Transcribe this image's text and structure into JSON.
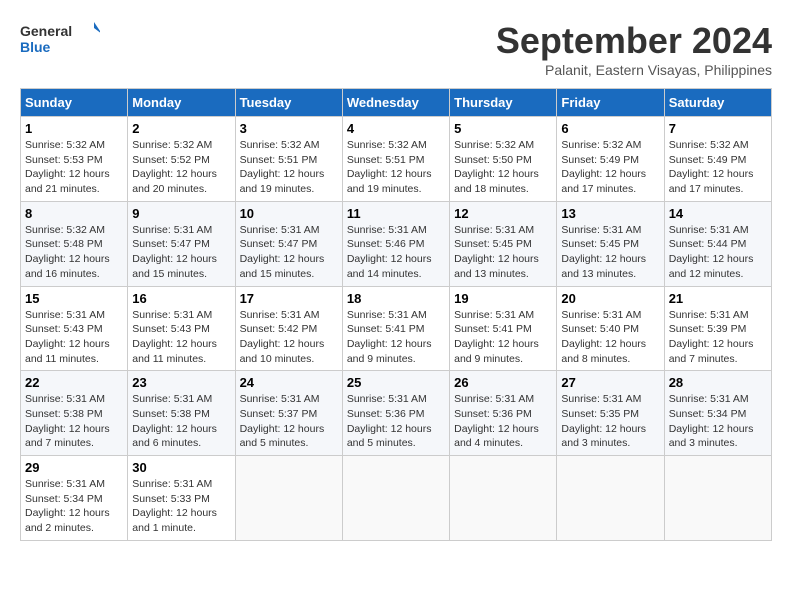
{
  "header": {
    "logo_line1": "General",
    "logo_line2": "Blue",
    "month": "September 2024",
    "location": "Palanit, Eastern Visayas, Philippines"
  },
  "weekdays": [
    "Sunday",
    "Monday",
    "Tuesday",
    "Wednesday",
    "Thursday",
    "Friday",
    "Saturday"
  ],
  "weeks": [
    [
      {
        "day": "1",
        "sunrise": "5:32 AM",
        "sunset": "5:53 PM",
        "daylight": "12 hours and 21 minutes."
      },
      {
        "day": "2",
        "sunrise": "5:32 AM",
        "sunset": "5:52 PM",
        "daylight": "12 hours and 20 minutes."
      },
      {
        "day": "3",
        "sunrise": "5:32 AM",
        "sunset": "5:51 PM",
        "daylight": "12 hours and 19 minutes."
      },
      {
        "day": "4",
        "sunrise": "5:32 AM",
        "sunset": "5:51 PM",
        "daylight": "12 hours and 19 minutes."
      },
      {
        "day": "5",
        "sunrise": "5:32 AM",
        "sunset": "5:50 PM",
        "daylight": "12 hours and 18 minutes."
      },
      {
        "day": "6",
        "sunrise": "5:32 AM",
        "sunset": "5:49 PM",
        "daylight": "12 hours and 17 minutes."
      },
      {
        "day": "7",
        "sunrise": "5:32 AM",
        "sunset": "5:49 PM",
        "daylight": "12 hours and 17 minutes."
      }
    ],
    [
      {
        "day": "8",
        "sunrise": "5:32 AM",
        "sunset": "5:48 PM",
        "daylight": "12 hours and 16 minutes."
      },
      {
        "day": "9",
        "sunrise": "5:31 AM",
        "sunset": "5:47 PM",
        "daylight": "12 hours and 15 minutes."
      },
      {
        "day": "10",
        "sunrise": "5:31 AM",
        "sunset": "5:47 PM",
        "daylight": "12 hours and 15 minutes."
      },
      {
        "day": "11",
        "sunrise": "5:31 AM",
        "sunset": "5:46 PM",
        "daylight": "12 hours and 14 minutes."
      },
      {
        "day": "12",
        "sunrise": "5:31 AM",
        "sunset": "5:45 PM",
        "daylight": "12 hours and 13 minutes."
      },
      {
        "day": "13",
        "sunrise": "5:31 AM",
        "sunset": "5:45 PM",
        "daylight": "12 hours and 13 minutes."
      },
      {
        "day": "14",
        "sunrise": "5:31 AM",
        "sunset": "5:44 PM",
        "daylight": "12 hours and 12 minutes."
      }
    ],
    [
      {
        "day": "15",
        "sunrise": "5:31 AM",
        "sunset": "5:43 PM",
        "daylight": "12 hours and 11 minutes."
      },
      {
        "day": "16",
        "sunrise": "5:31 AM",
        "sunset": "5:43 PM",
        "daylight": "12 hours and 11 minutes."
      },
      {
        "day": "17",
        "sunrise": "5:31 AM",
        "sunset": "5:42 PM",
        "daylight": "12 hours and 10 minutes."
      },
      {
        "day": "18",
        "sunrise": "5:31 AM",
        "sunset": "5:41 PM",
        "daylight": "12 hours and 9 minutes."
      },
      {
        "day": "19",
        "sunrise": "5:31 AM",
        "sunset": "5:41 PM",
        "daylight": "12 hours and 9 minutes."
      },
      {
        "day": "20",
        "sunrise": "5:31 AM",
        "sunset": "5:40 PM",
        "daylight": "12 hours and 8 minutes."
      },
      {
        "day": "21",
        "sunrise": "5:31 AM",
        "sunset": "5:39 PM",
        "daylight": "12 hours and 7 minutes."
      }
    ],
    [
      {
        "day": "22",
        "sunrise": "5:31 AM",
        "sunset": "5:38 PM",
        "daylight": "12 hours and 7 minutes."
      },
      {
        "day": "23",
        "sunrise": "5:31 AM",
        "sunset": "5:38 PM",
        "daylight": "12 hours and 6 minutes."
      },
      {
        "day": "24",
        "sunrise": "5:31 AM",
        "sunset": "5:37 PM",
        "daylight": "12 hours and 5 minutes."
      },
      {
        "day": "25",
        "sunrise": "5:31 AM",
        "sunset": "5:36 PM",
        "daylight": "12 hours and 5 minutes."
      },
      {
        "day": "26",
        "sunrise": "5:31 AM",
        "sunset": "5:36 PM",
        "daylight": "12 hours and 4 minutes."
      },
      {
        "day": "27",
        "sunrise": "5:31 AM",
        "sunset": "5:35 PM",
        "daylight": "12 hours and 3 minutes."
      },
      {
        "day": "28",
        "sunrise": "5:31 AM",
        "sunset": "5:34 PM",
        "daylight": "12 hours and 3 minutes."
      }
    ],
    [
      {
        "day": "29",
        "sunrise": "5:31 AM",
        "sunset": "5:34 PM",
        "daylight": "12 hours and 2 minutes."
      },
      {
        "day": "30",
        "sunrise": "5:31 AM",
        "sunset": "5:33 PM",
        "daylight": "12 hours and 1 minute."
      },
      null,
      null,
      null,
      null,
      null
    ]
  ]
}
